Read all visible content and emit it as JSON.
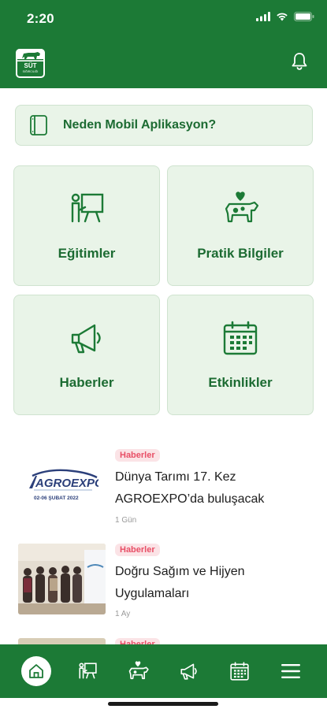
{
  "status": {
    "time": "2:20"
  },
  "header": {
    "logo_text": "SÜT",
    "logo_subtext": "SIĞIRCILIĞI"
  },
  "banner": {
    "label": "Neden Mobil Aplikasyon?"
  },
  "tiles": [
    {
      "label": "Eğitimler",
      "icon": "training-board-icon"
    },
    {
      "label": "Pratik Bilgiler",
      "icon": "cow-heart-icon"
    },
    {
      "label": "Haberler",
      "icon": "megaphone-icon"
    },
    {
      "label": "Etkinlikler",
      "icon": "calendar-icon"
    }
  ],
  "news": [
    {
      "category": "Haberler",
      "title": "Dünya Tarımı 17. Kez AGROEXPO’da buluşacak",
      "date": "1 Gün",
      "thumb": {
        "brand": "AGROEXPO",
        "subtitle": "02-06 ŞUBAT 2022"
      }
    },
    {
      "category": "Haberler",
      "title": "Doğru Sağım ve Hijyen Uygulamaları",
      "date": "1 Ay"
    },
    {
      "category": "Haberler"
    }
  ],
  "colors": {
    "primary": "#1c7a36",
    "tile_bg": "#e9f4e8",
    "badge_bg": "#fbe3e6",
    "badge_text": "#e84f66"
  }
}
